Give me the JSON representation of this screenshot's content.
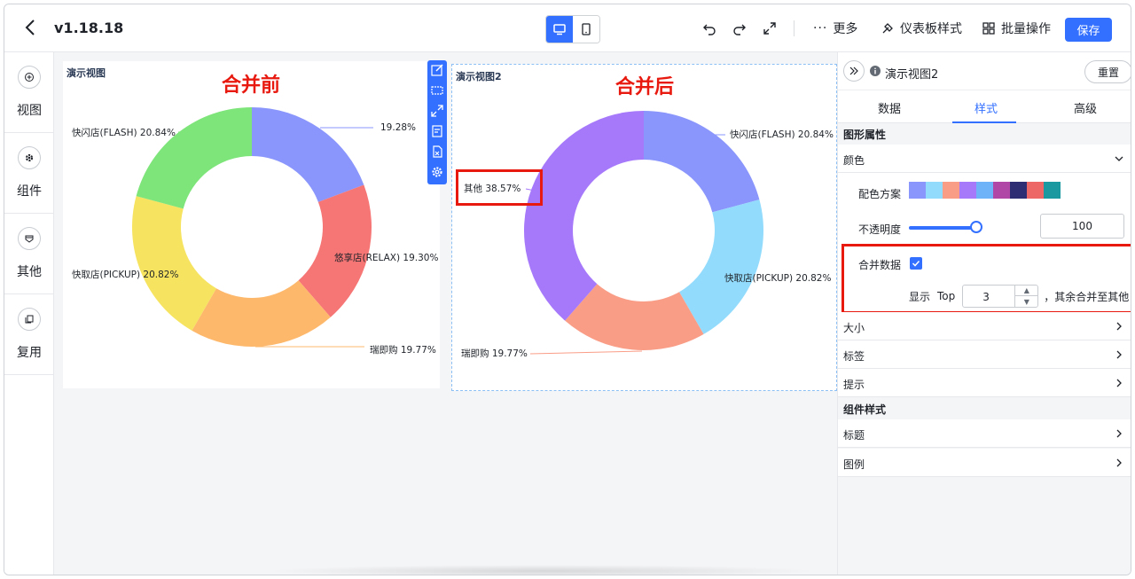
{
  "header": {
    "version": "v1.18.18",
    "more_label": "更多",
    "dashboard_style_label": "仪表板样式",
    "batch_label": "批量操作",
    "save_label": "保存"
  },
  "leftnav": {
    "items": [
      {
        "label": "视图",
        "icon": "plus-circle-icon"
      },
      {
        "label": "组件",
        "icon": "gear-icon"
      },
      {
        "label": "其他",
        "icon": "shield-icon"
      },
      {
        "label": "复用",
        "icon": "copy-icon"
      }
    ]
  },
  "views": [
    {
      "title": "演示视图",
      "heading": "合并前"
    },
    {
      "title": "演示视图2",
      "heading": "合并后"
    }
  ],
  "chart_data": [
    {
      "type": "pie",
      "variant": "donut",
      "title": "演示视图",
      "slices": [
        {
          "label": "19.28%",
          "value": 19.28,
          "color": "#8a96fb"
        },
        {
          "label": "悠享店(RELAX) 19.30%",
          "value": 19.3,
          "color": "#f67575"
        },
        {
          "label": "瑞即购 19.77%",
          "value": 19.77,
          "color": "#fdb86b"
        },
        {
          "label": "快取店(PICKUP) 20.82%",
          "value": 20.82,
          "color": "#f6e35f"
        },
        {
          "label": "快闪店(FLASH) 20.84%",
          "value": 20.84,
          "color": "#7ee57a"
        }
      ]
    },
    {
      "type": "pie",
      "variant": "donut",
      "title": "演示视图2",
      "slices": [
        {
          "label": "快闪店(FLASH) 20.84%",
          "value": 20.84,
          "color": "#8a96fb"
        },
        {
          "label": "快取店(PICKUP) 20.82%",
          "value": 20.82,
          "color": "#92dbfc"
        },
        {
          "label": "瑞即购 19.77%",
          "value": 19.77,
          "color": "#fa9d87"
        },
        {
          "label": "其他 38.57%",
          "value": 38.57,
          "color": "#a679fb"
        }
      ]
    }
  ],
  "panel": {
    "view_name": "演示视图2",
    "reset_label": "重置",
    "tabs": [
      "数据",
      "样式",
      "高级"
    ],
    "active_tab": "样式",
    "graphic_section": "图形属性",
    "color_label": "颜色",
    "scheme_label": "配色方案",
    "scheme_colors": [
      "#8a96fb",
      "#92dbfc",
      "#fa9d87",
      "#a679fb",
      "#6eb3f7",
      "#b046a6",
      "#2e2d73",
      "#ee6767",
      "#1a9aa0"
    ],
    "opacity_label": "不透明度",
    "opacity_value": "100",
    "merge_label": "合并数据",
    "merge_checked": true,
    "show_label": "显示",
    "top_label": "Top",
    "top_value": "3",
    "rest_label": "，其余合并至其他",
    "rows": [
      "大小",
      "标签",
      "提示"
    ],
    "component_section": "组件样式",
    "component_rows": [
      "标题",
      "图例"
    ]
  }
}
